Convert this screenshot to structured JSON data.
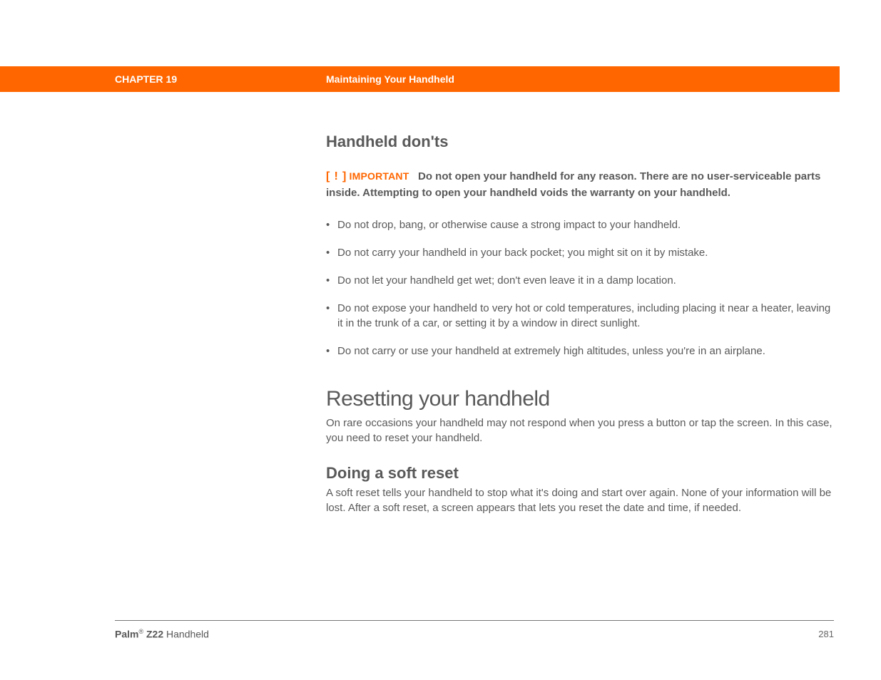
{
  "header": {
    "chapter_label": "CHAPTER 19",
    "chapter_title": "Maintaining Your Handheld"
  },
  "sections": {
    "donts": {
      "heading": "Handheld don'ts",
      "important_bracket_open": "[",
      "important_bang": "!",
      "important_bracket_close": "]",
      "important_label": "IMPORTANT",
      "important_text": "Do not open your handheld for any reason. There are no user-serviceable parts inside. Attempting to open your handheld voids the warranty on your handheld.",
      "bullets": [
        "Do not drop, bang, or otherwise cause a strong impact to your handheld.",
        "Do not carry your handheld in your back pocket; you might sit on it by mistake.",
        "Do not let your handheld get wet; don't even leave it in a damp location.",
        "Do not expose your handheld to very hot or cold temperatures, including placing it near a heater, leaving it in the trunk of a car, or setting it by a window in direct sunlight.",
        "Do not carry or use your handheld at extremely high altitudes, unless you're in an airplane."
      ]
    },
    "resetting": {
      "heading": "Resetting your handheld",
      "intro": "On rare occasions your handheld may not respond when you press a button or tap the screen. In this case, you need to reset your handheld."
    },
    "soft_reset": {
      "heading": "Doing a soft reset",
      "body": "A soft reset tells your handheld to stop what it's doing and start over again. None of your information will be lost. After a soft reset, a screen appears that lets you reset the date and time, if needed."
    }
  },
  "footer": {
    "brand": "Palm",
    "reg": "®",
    "model": " Z22",
    "suffix": " Handheld",
    "page": "281"
  }
}
